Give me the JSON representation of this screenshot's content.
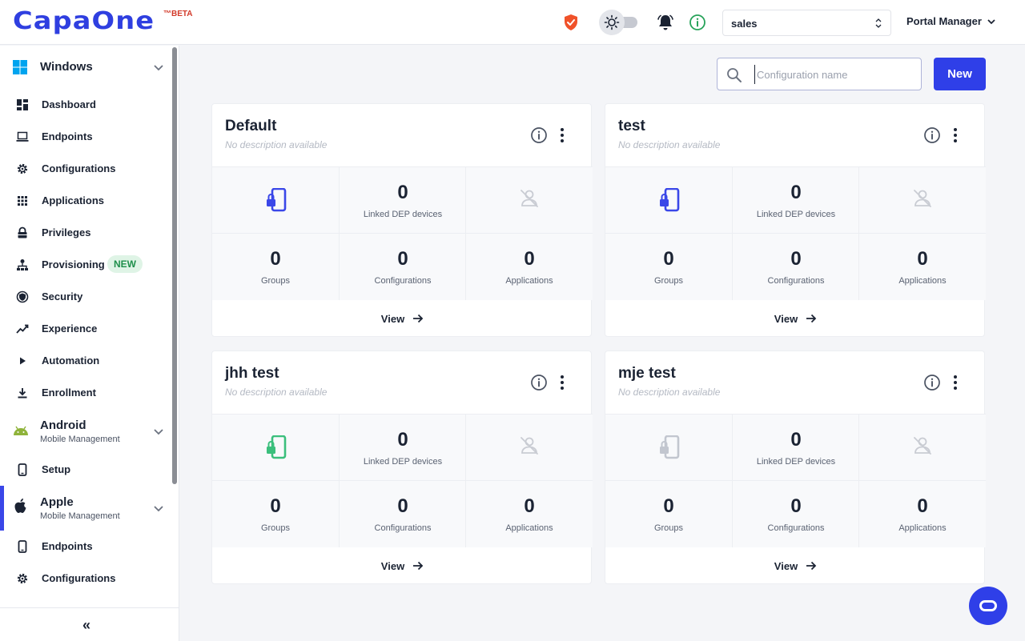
{
  "brand": {
    "name": "CapaOne",
    "suffix": "™BETA",
    "color": "#2f3fe0"
  },
  "header": {
    "org_select": "sales",
    "user_menu": "Portal Manager",
    "icons": [
      "shield-icon",
      "theme-toggle",
      "bell-icon",
      "info-icon"
    ]
  },
  "sidebar": {
    "windows": {
      "title": "Windows",
      "items": [
        {
          "label": "Dashboard",
          "icon": "dashboard-icon"
        },
        {
          "label": "Endpoints",
          "icon": "laptop-icon"
        },
        {
          "label": "Configurations",
          "icon": "gear-icon"
        },
        {
          "label": "Applications",
          "icon": "apps-grid-icon"
        },
        {
          "label": "Privileges",
          "icon": "lock-icon"
        },
        {
          "label": "Provisioning",
          "icon": "sitemap-icon",
          "badge": "NEW"
        },
        {
          "label": "Security",
          "icon": "shield-check-icon"
        },
        {
          "label": "Experience",
          "icon": "trend-icon"
        },
        {
          "label": "Automation",
          "icon": "play-icon"
        },
        {
          "label": "Enrollment",
          "icon": "download-icon"
        }
      ]
    },
    "android": {
      "title": "Android",
      "subtitle": "Mobile Management",
      "items": [
        {
          "label": "Setup",
          "icon": "phone-icon"
        }
      ]
    },
    "apple": {
      "title": "Apple",
      "subtitle": "Mobile Management",
      "items": [
        {
          "label": "Endpoints",
          "icon": "phone-icon"
        },
        {
          "label": "Configurations",
          "icon": "gear-icon"
        }
      ]
    },
    "collapse_label": "«"
  },
  "toolbar": {
    "search_placeholder": "Configuration name",
    "new_label": "New"
  },
  "cards": [
    {
      "title": "Default",
      "description": "No description available",
      "dep_icon_color": "#3a47e8",
      "linked_dep": "0",
      "linked_dep_label": "Linked DEP devices",
      "groups": "0",
      "groups_label": "Groups",
      "configurations": "0",
      "configurations_label": "Configurations",
      "applications": "0",
      "applications_label": "Applications",
      "view_label": "View"
    },
    {
      "title": "test",
      "description": "No description available",
      "dep_icon_color": "#3a47e8",
      "linked_dep": "0",
      "linked_dep_label": "Linked DEP devices",
      "groups": "0",
      "groups_label": "Groups",
      "configurations": "0",
      "configurations_label": "Configurations",
      "applications": "0",
      "applications_label": "Applications",
      "view_label": "View"
    },
    {
      "title": "jhh test",
      "description": "No description available",
      "dep_icon_color": "#3bbf7c",
      "linked_dep": "0",
      "linked_dep_label": "Linked DEP devices",
      "groups": "0",
      "groups_label": "Groups",
      "configurations": "0",
      "configurations_label": "Configurations",
      "applications": "0",
      "applications_label": "Applications",
      "view_label": "View"
    },
    {
      "title": "mje test",
      "description": "No description available",
      "dep_icon_color": "#c2c6cf",
      "linked_dep": "0",
      "linked_dep_label": "Linked DEP devices",
      "groups": "0",
      "groups_label": "Groups",
      "configurations": "0",
      "configurations_label": "Configurations",
      "applications": "0",
      "applications_label": "Applications",
      "view_label": "View"
    }
  ],
  "colors": {
    "accent": "#2f3fe8",
    "shield": "#f0522a",
    "info": "#27a35a",
    "new_badge_bg": "#dff4e6",
    "new_badge_fg": "#1e8f4b"
  }
}
